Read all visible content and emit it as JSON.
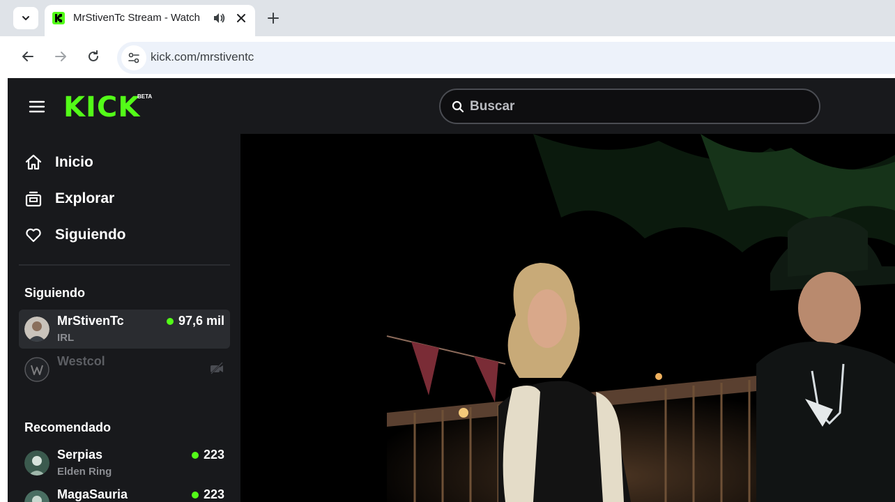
{
  "browser": {
    "tab": {
      "title": "MrStivenTc Stream - Watch"
    },
    "url": "kick.com/mrstiventc"
  },
  "header": {
    "logo": "KICK",
    "beta": "BETA",
    "search_placeholder": "Buscar"
  },
  "nav": [
    {
      "label": "Inicio",
      "icon": "home-icon"
    },
    {
      "label": "Explorar",
      "icon": "browse-icon"
    },
    {
      "label": "Siguiendo",
      "icon": "heart-icon"
    }
  ],
  "following": {
    "title": "Siguiendo",
    "channels": [
      {
        "name": "MrStivenTc",
        "category": "IRL",
        "viewers": "97,6 mil",
        "live": true
      },
      {
        "name": "Westcol",
        "live": false
      }
    ]
  },
  "recommended": {
    "title": "Recomendado",
    "channels": [
      {
        "name": "Serpias",
        "category": "Elden Ring",
        "viewers": "223"
      },
      {
        "name": "MagaSauria",
        "viewers": "223"
      }
    ]
  },
  "colors": {
    "brand": "#53fc18",
    "background": "#0e0e10",
    "sidebar": "#18191c"
  }
}
